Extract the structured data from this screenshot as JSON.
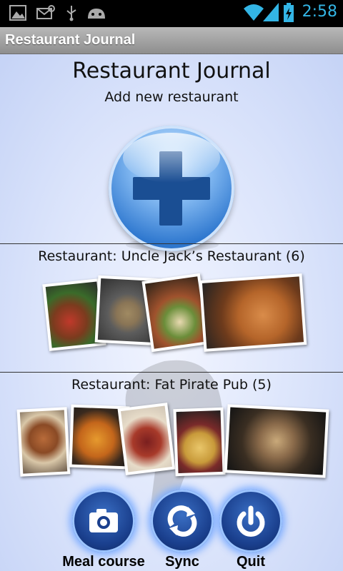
{
  "status_bar": {
    "time": "2:58",
    "icons": [
      "gallery-icon",
      "missed-call-icon",
      "usb-icon",
      "android-icon",
      "wifi-icon",
      "signal-icon",
      "battery-charging-icon"
    ]
  },
  "title_bar": {
    "title": "Restaurant Journal"
  },
  "header": {
    "title": "Restaurant Journal",
    "add_label": "Add new restaurant",
    "add_icon": "plus-icon"
  },
  "restaurants": [
    {
      "label": "Restaurant: Uncle Jack’s Restaurant (6)"
    },
    {
      "label": "Restaurant: Fat Pirate Pub (5)"
    }
  ],
  "actions": [
    {
      "label": "Meal course",
      "icon": "camera-icon"
    },
    {
      "label": "Sync",
      "icon": "sync-icon"
    },
    {
      "label": "Quit",
      "icon": "power-icon"
    }
  ],
  "colors": {
    "accent": "#33b5e5",
    "button_blue": "#1a3f8d",
    "plus_blue": "#1a4e93"
  }
}
